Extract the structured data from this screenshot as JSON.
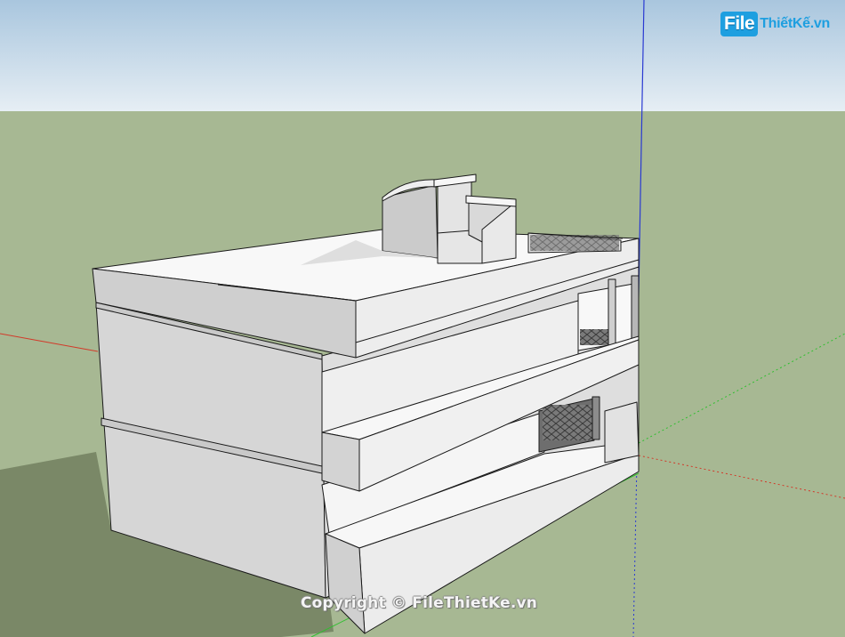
{
  "viewport": {
    "sky_color": "#c6d9e8",
    "ground_color": "#a6b792",
    "axis_colors": {
      "red": "#d23a2a",
      "green": "#2fbf2f",
      "blue": "#2a3ad2"
    }
  },
  "model": {
    "wall_color": "#d8d8d8",
    "shadow_wall_color": "#bdbdbd",
    "bright_color": "#f6f6f6",
    "edge_color": "#1a1a1a"
  },
  "watermark": {
    "logo_badge": "File",
    "logo_text": "ThiếtKế.vn",
    "copyright": "Copyright © FileThietKe.vn"
  }
}
